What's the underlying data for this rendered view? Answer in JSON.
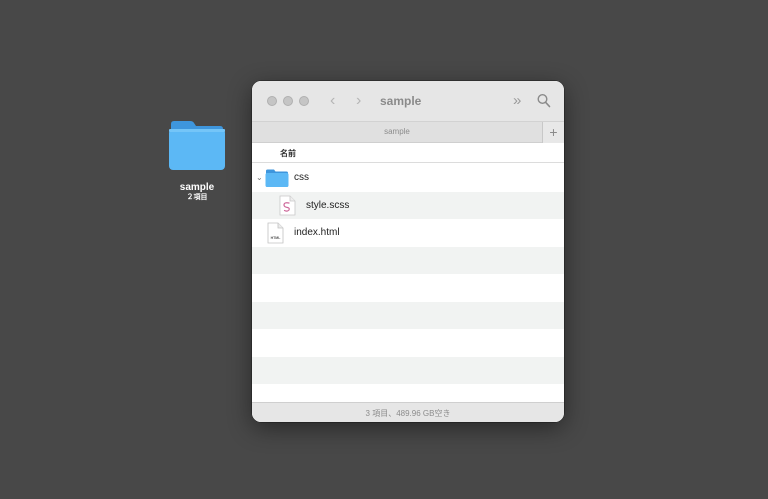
{
  "desktop": {
    "folder_name": "sample",
    "folder_subtitle": "２項目",
    "folder_color": "#5ab4f0"
  },
  "window": {
    "title": "sample",
    "nav_back": "‹",
    "nav_forward": "›",
    "more_glyph": "»",
    "tab_label": "sample",
    "tab_add": "+",
    "column_name": "名前",
    "disclosure": "⌄",
    "items": [
      {
        "name": "css",
        "icon": "folder-icon"
      },
      {
        "name": "style.scss",
        "icon": "scss-file-icon"
      },
      {
        "name": "index.html",
        "icon": "html-file-icon",
        "icon_label": "HTML"
      }
    ],
    "status": "3 項目、489.96 GB空き"
  }
}
